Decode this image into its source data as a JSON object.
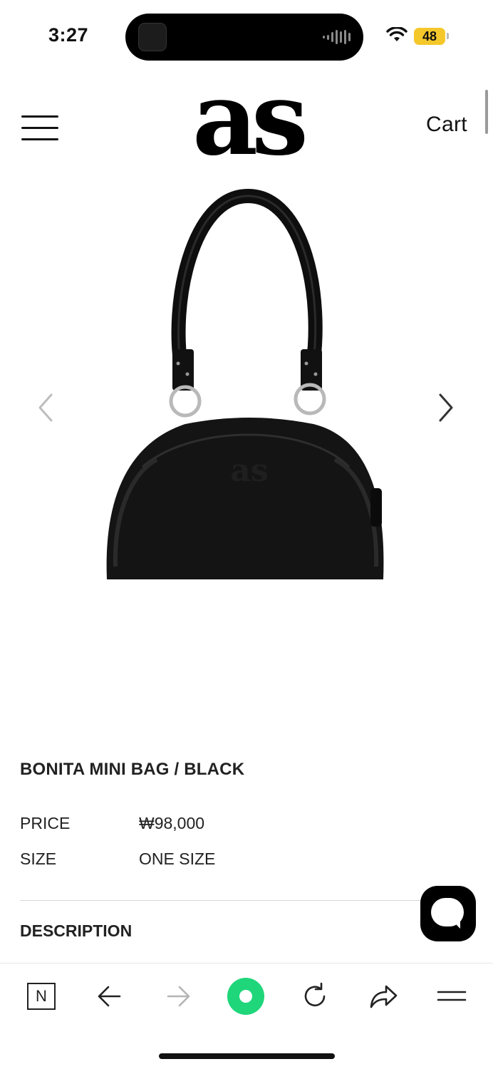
{
  "status_bar": {
    "time": "3:27",
    "battery_level": "48",
    "icons": [
      "audio-wave-icon",
      "wifi-icon",
      "battery-icon"
    ]
  },
  "header": {
    "logo_text": "as",
    "cart_label": "Cart",
    "menu_icon": "hamburger-menu-icon"
  },
  "gallery": {
    "image_subject": "black shoulder bag",
    "prev_icon": "chevron-left-icon",
    "next_icon": "chevron-right-icon"
  },
  "product": {
    "title": "BONITA MINI BAG / BLACK",
    "price_label": "PRICE",
    "price_value": "₩98,000",
    "size_label": "SIZE",
    "size_value": "ONE SIZE",
    "description_label": "DESCRIPTION"
  },
  "chat_button": {
    "icon": "chat-bubble-icon"
  },
  "browser_toolbar": {
    "n_label": "N",
    "items": [
      "naver-icon",
      "back-arrow-icon",
      "forward-arrow-icon",
      "green-dot-home-icon",
      "reload-icon",
      "share-icon",
      "menu-icon"
    ]
  },
  "colors": {
    "accent_green": "#1fd67a",
    "battery_yellow": "#f4c82b",
    "text": "#222222"
  }
}
